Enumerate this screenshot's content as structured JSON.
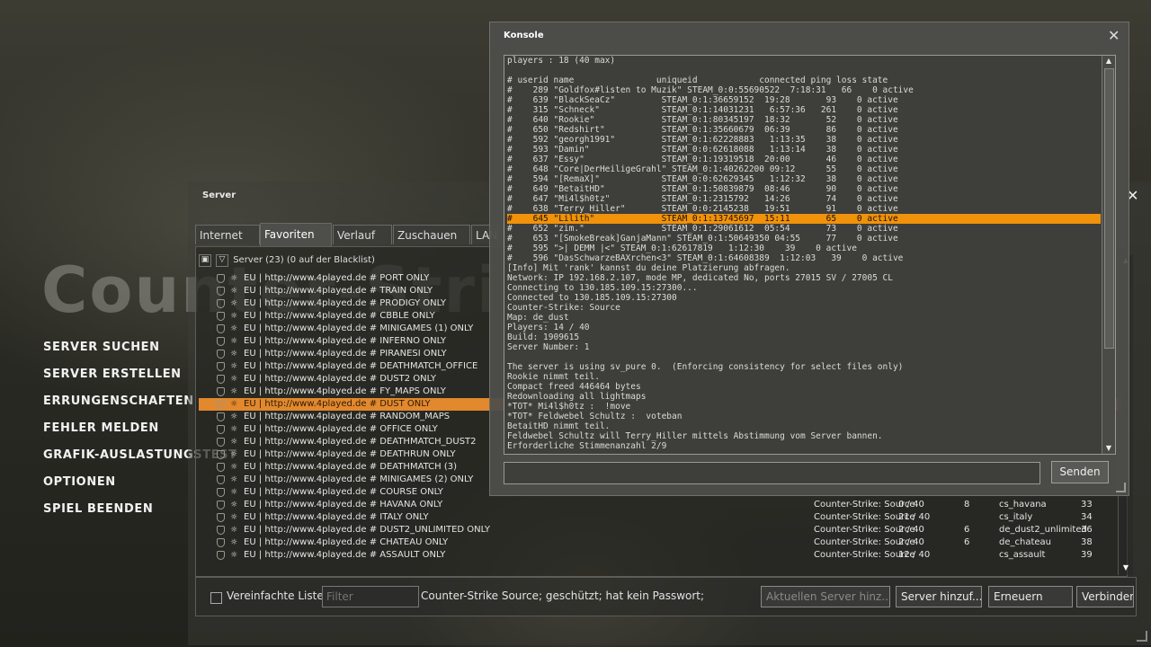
{
  "logo_text": "Counter-Strike",
  "main_menu": [
    "SERVER SUCHEN",
    "SERVER ERSTELLEN",
    "ERRUNGENSCHAFTEN",
    "FEHLER MELDEN",
    "GRAFIK-AUSLASTUNGSTEST",
    "OPTIONEN",
    "SPIEL BEENDEN"
  ],
  "server_browser": {
    "title": "Server",
    "close": "✕",
    "tabs": [
      "Internet",
      "Favoriten",
      "Verlauf",
      "Zuschauen",
      "LAN"
    ],
    "active_tab": "Favoriten",
    "header": "Server (23) (0 auf der Blacklist)",
    "header_icons": [
      "lock-icon",
      "shield-icon"
    ],
    "secure_glyph": "☼",
    "rows": [
      {
        "name": "EU | http://www.4played.de # PORT ONLY"
      },
      {
        "name": "EU | http://www.4played.de # TRAIN ONLY"
      },
      {
        "name": "EU | http://www.4played.de # PRODIGY ONLY"
      },
      {
        "name": "EU | http://www.4played.de # CBBLE ONLY"
      },
      {
        "name": "EU | http://www.4played.de # MINIGAMES (1) ONLY"
      },
      {
        "name": "EU | http://www.4played.de # INFERNO ONLY"
      },
      {
        "name": "EU | http://www.4played.de # PIRANESI ONLY"
      },
      {
        "name": "EU | http://www.4played.de # DEATHMATCH_OFFICE"
      },
      {
        "name": "EU | http://www.4played.de # DUST2 ONLY"
      },
      {
        "name": "EU | http://www.4played.de # FY_MAPS ONLY"
      },
      {
        "name": "EU | http://www.4played.de # DUST ONLY",
        "selected": true
      },
      {
        "name": "EU | http://www.4played.de # RANDOM_MAPS"
      },
      {
        "name": "EU | http://www.4played.de # OFFICE ONLY"
      },
      {
        "name": "EU | http://www.4played.de # DEATHMATCH_DUST2"
      },
      {
        "name": "EU | http://www.4played.de # DEATHRUN ONLY"
      },
      {
        "name": "EU | http://www.4played.de # DEATHMATCH (3)"
      },
      {
        "name": "EU | http://www.4played.de # MINIGAMES (2) ONLY"
      },
      {
        "name": "EU | http://www.4played.de # COURSE ONLY"
      },
      {
        "name": "EU | http://www.4played.de # HAVANA ONLY",
        "game": "Counter-Strike: Source",
        "players": "0 / 40",
        "bots": "8",
        "map": "cs_havana",
        "ping": "33"
      },
      {
        "name": "EU | http://www.4played.de # ITALY ONLY",
        "game": "Counter-Strike: Source",
        "players": "21 / 40",
        "bots": "",
        "map": "cs_italy",
        "ping": "34"
      },
      {
        "name": "EU | http://www.4played.de # DUST2_UNLIMITED ONLY",
        "game": "Counter-Strike: Source",
        "players": "2 / 40",
        "bots": "6",
        "map": "de_dust2_unlimited",
        "ping": "36"
      },
      {
        "name": "EU | http://www.4played.de # CHATEAU ONLY",
        "game": "Counter-Strike: Source",
        "players": "2 / 40",
        "bots": "6",
        "map": "de_chateau",
        "ping": "38"
      },
      {
        "name": "EU | http://www.4played.de # ASSAULT ONLY",
        "game": "Counter-Strike: Source",
        "players": "12 / 40",
        "bots": "",
        "map": "cs_assault",
        "ping": "39"
      }
    ],
    "simple_list_label": "Vereinfachte Liste",
    "filter_placeholder": "Filter",
    "server_info": "Counter-Strike Source; geschützt; hat kein Passwort;",
    "buttons": [
      "Aktuellen Server hinz...",
      "Server hinzuf...",
      "Erneuern",
      "Verbinden"
    ],
    "scroll_up": "▲",
    "scroll_down": "▼"
  },
  "console": {
    "title": "Konsole",
    "close": "✕",
    "highlight_index": 16,
    "lines": [
      "players : 18 (40 max)",
      "",
      "# userid name                uniqueid            connected ping loss state",
      "#    289 \"Goldfox#listen to Muzik\" STEAM_0:0:55690522  7:18:31   66    0 active",
      "#    639 \"BlackSeaCz\"         STEAM_0:1:36659152  19:28       93    0 active",
      "#    315 \"Schneck\"            STEAM_0:1:14031231   6:57:36   261    0 active",
      "#    640 \"Rookie\"             STEAM_0:1:80345197  18:32       52    0 active",
      "#    650 \"Redshirt\"           STEAM_0:1:35660679  06:39       86    0 active",
      "#    592 \"georgh1991\"         STEAM_0:1:62228883   1:13:35    38    0 active",
      "#    593 \"Damin\"              STEAM_0:0:62618088   1:13:14    38    0 active",
      "#    637 \"Essy\"               STEAM_0:1:19319518  20:00       46    0 active",
      "#    648 \"Core|DerHeiligeGrahl\" STEAM_0:1:40262200 09:12      55    0 active",
      "#    594 \"[RemaX]\"            STEAM_0:0:62629345   1:12:32    38    0 active",
      "#    649 \"BetaitHD\"           STEAM_0:1:50839879  08:46       90    0 active",
      "#    647 \"Mi4l$h0tz\"          STEAM_0:1:2315792   14:26       74    0 active",
      "#    638 \"Terry_Hiller\"       STEAM_0:0:2145238   19:51       91    0 active",
      "#    645 \"Lilith\"             STEAM_0:1:13745697  15:11       65    0 active",
      "#    652 \"zim.\"               STEAM_0:1:29061612  05:54       73    0 active",
      "#    653 \"[SmokeBreak]GanjaMann\" STEAM_0:1:50649350 04:55     77    0 active",
      "#    595 \">| DEMM |<\" STEAM_0:1:62617819   1:12:30    39    0 active",
      "#    596 \"DasSchwarzeBAXrchen<3\" STEAM_0:1:64608389  1:12:03   39    0 active",
      "[Info] Mit 'rank' kannst du deine Platzierung abfragen.",
      "Network: IP 192.168.2.107, mode MP, dedicated No, ports 27015 SV / 27005 CL",
      "Connecting to 130.185.109.15:27300...",
      "Connected to 130.185.109.15:27300",
      "Counter-Strike: Source",
      "Map: de_dust",
      "Players: 14 / 40",
      "Build: 1909615",
      "Server Number: 1",
      "",
      "The server is using sv_pure 0.  (Enforcing consistency for select files only)",
      "Rookie nimmt teil.",
      "Compact freed 446464 bytes",
      "Redownloading all lightmaps",
      "*TOT* Mi4l$h0tz :  !move",
      "*TOT* Feldwebel Schultz :  voteban",
      "BetaitHD nimmt teil.",
      "Feldwebel Schultz will Terry_Hiller mittels Abstimmung vom Server bannen.",
      "Erforderliche Stimmenanzahl 2/9"
    ],
    "input_value": "",
    "send_label": "Senden",
    "scroll_up": "▲",
    "scroll_down": "▼"
  }
}
